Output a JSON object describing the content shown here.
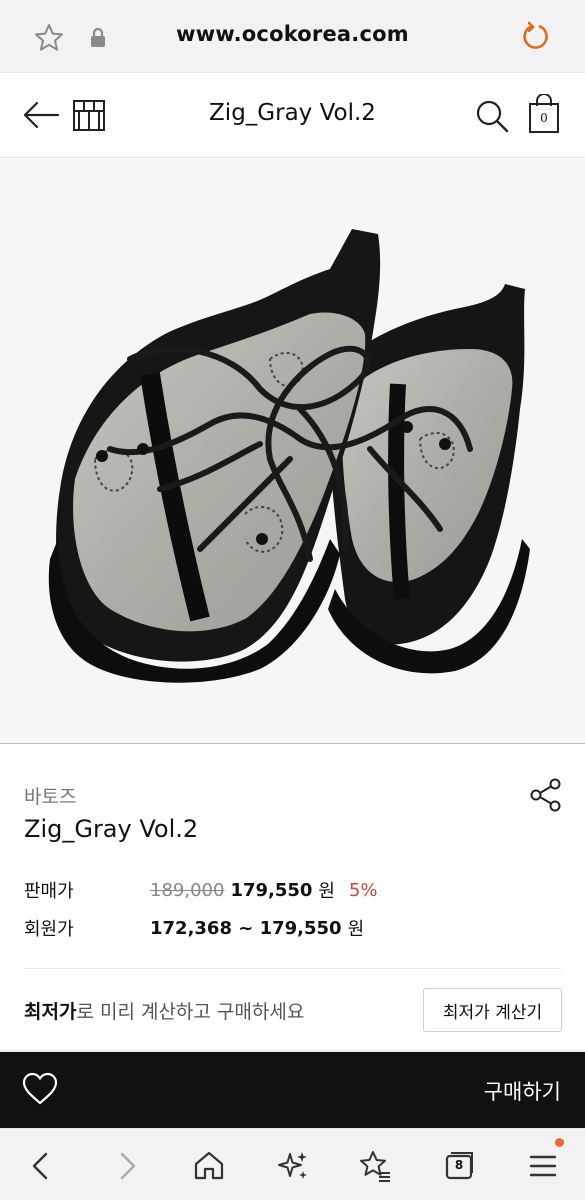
{
  "browser": {
    "url": "www.ocokorea.com",
    "icons": {
      "favorite": "star-icon",
      "lock": "lock-icon",
      "reload": "reload-icon"
    },
    "reload_color": "#e06a1e"
  },
  "header": {
    "title": "Zig_Gray Vol.2",
    "cart_count": "0",
    "icons": [
      "back-arrow-icon",
      "store-icon",
      "search-icon",
      "cart-icon"
    ]
  },
  "product": {
    "image_alt": "shoe-product-image",
    "brand": "바토즈",
    "name": "Zig_Gray Vol.2",
    "sale_label": "판매가",
    "original_price": "189,000",
    "sale_price": "179,550",
    "currency": "원",
    "discount": "5%",
    "member_label": "회원가",
    "member_price": "172,368 ~ 179,550",
    "member_currency": "원"
  },
  "lowest": {
    "text_bold": "최저가",
    "text_rest": "로 미리 계산하고 구매하세요",
    "button": "최저가 계산기"
  },
  "buy_bar": {
    "buy_label": "구매하기",
    "icons": [
      "heart-icon"
    ]
  },
  "bottom_nav": {
    "tabs_count": "8",
    "icons": [
      "back-icon",
      "forward-icon",
      "home-icon",
      "sparkle-icon",
      "bookmarks-icon",
      "tabs-icon",
      "menu-icon"
    ],
    "notification_color": "#ef6b2c"
  },
  "colors": {
    "discount": "#d0443a",
    "buy_bar": "#111111"
  }
}
